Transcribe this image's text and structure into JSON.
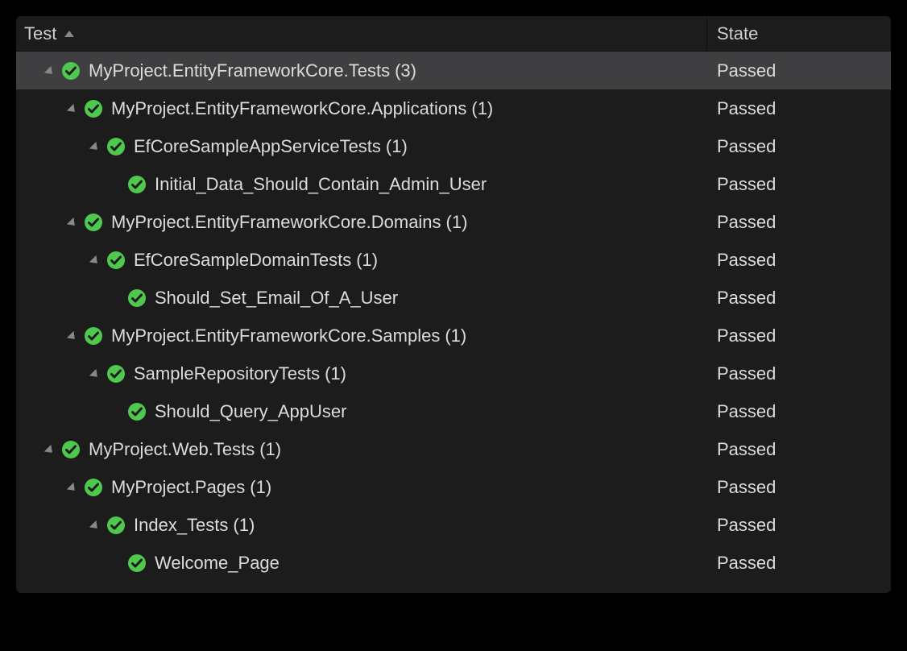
{
  "columns": {
    "test": "Test",
    "state": "State"
  },
  "status_color": "#4ec94e",
  "rows": [
    {
      "indent": 0,
      "expander": true,
      "label": "MyProject.EntityFrameworkCore.Tests",
      "count": "(3)",
      "state": "Passed",
      "selected": true
    },
    {
      "indent": 1,
      "expander": true,
      "label": "MyProject.EntityFrameworkCore.Applications",
      "count": "(1)",
      "state": "Passed",
      "selected": false
    },
    {
      "indent": 2,
      "expander": true,
      "label": "EfCoreSampleAppServiceTests",
      "count": "(1)",
      "state": "Passed",
      "selected": false
    },
    {
      "indent": 3,
      "expander": false,
      "label": "Initial_Data_Should_Contain_Admin_User",
      "count": "",
      "state": "Passed",
      "selected": false
    },
    {
      "indent": 1,
      "expander": true,
      "label": "MyProject.EntityFrameworkCore.Domains",
      "count": "(1)",
      "state": "Passed",
      "selected": false
    },
    {
      "indent": 2,
      "expander": true,
      "label": "EfCoreSampleDomainTests",
      "count": "(1)",
      "state": "Passed",
      "selected": false
    },
    {
      "indent": 3,
      "expander": false,
      "label": "Should_Set_Email_Of_A_User",
      "count": "",
      "state": "Passed",
      "selected": false
    },
    {
      "indent": 1,
      "expander": true,
      "label": "MyProject.EntityFrameworkCore.Samples",
      "count": "(1)",
      "state": "Passed",
      "selected": false
    },
    {
      "indent": 2,
      "expander": true,
      "label": "SampleRepositoryTests",
      "count": "(1)",
      "state": "Passed",
      "selected": false
    },
    {
      "indent": 3,
      "expander": false,
      "label": "Should_Query_AppUser",
      "count": "",
      "state": "Passed",
      "selected": false
    },
    {
      "indent": 0,
      "expander": true,
      "label": "MyProject.Web.Tests",
      "count": "(1)",
      "state": "Passed",
      "selected": false
    },
    {
      "indent": 1,
      "expander": true,
      "label": "MyProject.Pages",
      "count": "(1)",
      "state": "Passed",
      "selected": false
    },
    {
      "indent": 2,
      "expander": true,
      "label": "Index_Tests",
      "count": "(1)",
      "state": "Passed",
      "selected": false
    },
    {
      "indent": 3,
      "expander": false,
      "label": "Welcome_Page",
      "count": "",
      "state": "Passed",
      "selected": false
    }
  ]
}
